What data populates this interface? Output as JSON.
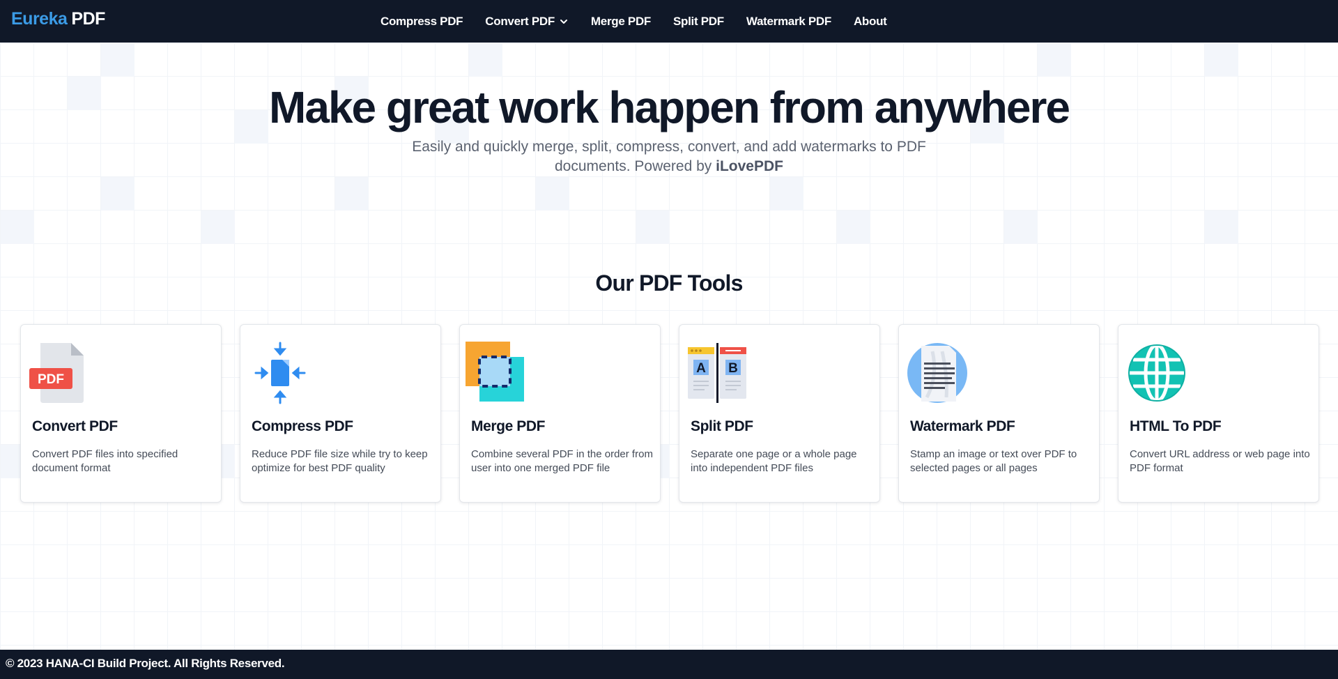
{
  "navbar": {
    "brand_part1": "Eureka",
    "brand_part2": "PDF",
    "links": [
      {
        "label": "Compress PDF"
      },
      {
        "label": "Convert PDF"
      },
      {
        "label": "Merge PDF"
      },
      {
        "label": "Split PDF"
      },
      {
        "label": "Watermark PDF"
      },
      {
        "label": "About"
      }
    ]
  },
  "hero": {
    "title": "Make great work happen from anywhere",
    "subtitle": "Easily and quickly merge, split, compress, convert, and add watermarks to PDF documents. Powered by",
    "powered_by": "iLovePDF"
  },
  "tools_section": {
    "title": "Our PDF Tools",
    "cards": [
      {
        "title": "Convert PDF",
        "description": "Convert PDF files into specified document format",
        "icon": "pdf-file-icon",
        "badge": "PDF"
      },
      {
        "title": "Compress PDF",
        "description": "Reduce PDF file size while try to keep optimize for best PDF quality",
        "icon": "compress-icon"
      },
      {
        "title": "Merge PDF",
        "description": "Combine several PDF in the order from user into one merged PDF file",
        "icon": "merge-icon"
      },
      {
        "title": "Split PDF",
        "description": "Separate one page or a whole page into independent PDF files",
        "icon": "split-icon",
        "label_a": "A",
        "label_b": "B"
      },
      {
        "title": "Watermark PDF",
        "description": "Stamp an image or text over PDF to selected pages or all pages",
        "icon": "watermark-icon"
      },
      {
        "title": "HTML To PDF",
        "description": "Convert URL address or web page into PDF format",
        "icon": "globe-icon"
      }
    ]
  },
  "footer": {
    "text": "© 2023 HANA-CI Build Project. All Rights Reserved."
  },
  "colors": {
    "nav_bg": "#101828",
    "brand_accent": "#3b9be6"
  }
}
